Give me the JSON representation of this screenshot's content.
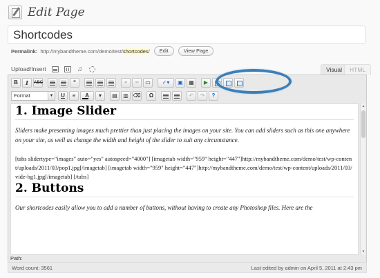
{
  "header": {
    "title": "Edit Page"
  },
  "title_field": {
    "value": "Shortcodes"
  },
  "permalink": {
    "label": "Permalink:",
    "url_prefix": "http://mybandtheme.com/demo/test/",
    "slug": "shortcodes",
    "url_suffix": "/",
    "edit_label": "Edit",
    "view_label": "View Page"
  },
  "upload": {
    "label": "Upload/Insert",
    "icons": [
      "image-icon",
      "video-icon",
      "audio-icon",
      "media-icon"
    ]
  },
  "tabs": {
    "visual": "Visual",
    "html": "HTML"
  },
  "toolbar": {
    "bold": "B",
    "italic": "I",
    "strike": "ABC",
    "blockquote": "“",
    "format_select": "Format",
    "underline": "U",
    "justify_full": "≡",
    "text_color": "A",
    "omega": "Ω",
    "undo": "↶",
    "redo": "↷",
    "help": "?",
    "shortcode_buttons": [
      "slider-shortcode",
      "tabs-shortcode",
      "box-shortcode",
      "columns-shortcode"
    ]
  },
  "content": {
    "section1": {
      "heading": "1. Image Slider",
      "intro": "Sliders make presenting images much prettier than just placing the images on your site. You can add sliders such as this one anywhere on your site, as well as change the width and height of the slider to suit any circumstance.",
      "code": "[tabs slidertype=\"images\" auto=\"yes\" autospeed=\"4000\"] [imagetab width=\"959\" height=\"447\"]http://mybandtheme.com/demo/test/wp-content/uploads/2011/03/pop1.jpg[/imagetab] [imagetab width=\"959\" height=\"447\"]http://mybandtheme.com/demo/test/wp-content/uploads/2011/03/vide-bg1.jpg[/imagetab] [/tabs]"
    },
    "section2": {
      "heading": "2. Buttons",
      "intro": "Our shortcodes easily allow you to add a number of buttons, without having to create any Photoshop files. Here are the"
    }
  },
  "path": {
    "label": "Path:"
  },
  "footer": {
    "word_count": "Word count: 3561",
    "last_edited": "Last edited by admin on April 5, 2011 at 2:43 pm"
  },
  "colors": {
    "highlight": "#3b7fb9",
    "slug_bg": "#fffbcc"
  }
}
